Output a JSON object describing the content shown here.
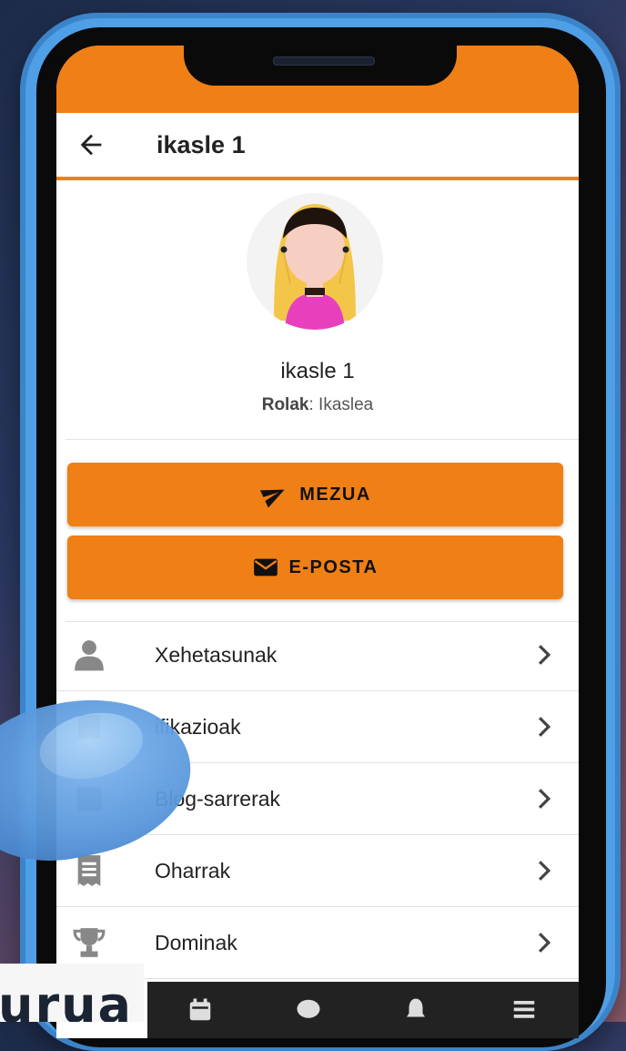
{
  "header": {
    "title": "ikasle 1"
  },
  "profile": {
    "name": "ikasle 1",
    "roles_label": "Rolak",
    "roles_separator": ": ",
    "roles_value": "Ikaslea"
  },
  "actions": [
    {
      "label": "MEZUA",
      "icon": "send-icon"
    },
    {
      "label": "E-POSTA",
      "icon": "mail-icon"
    }
  ],
  "menu": [
    {
      "label": "Xehetasunak",
      "icon": "person-icon"
    },
    {
      "label": "ifikazioak",
      "icon": "badge-icon"
    },
    {
      "label": "Blog-sarrerak",
      "icon": "blog-icon"
    },
    {
      "label": "Oharrak",
      "icon": "notes-icon"
    },
    {
      "label": "Dominak",
      "icon": "trophy-icon"
    }
  ],
  "bottom_nav": [
    "calendar-icon",
    "chat-icon",
    "notification-icon",
    "menu-icon"
  ],
  "caption": "urua",
  "colors": {
    "accent": "#f07f15",
    "frame": "#4f9fe6",
    "nav": "#222222"
  }
}
